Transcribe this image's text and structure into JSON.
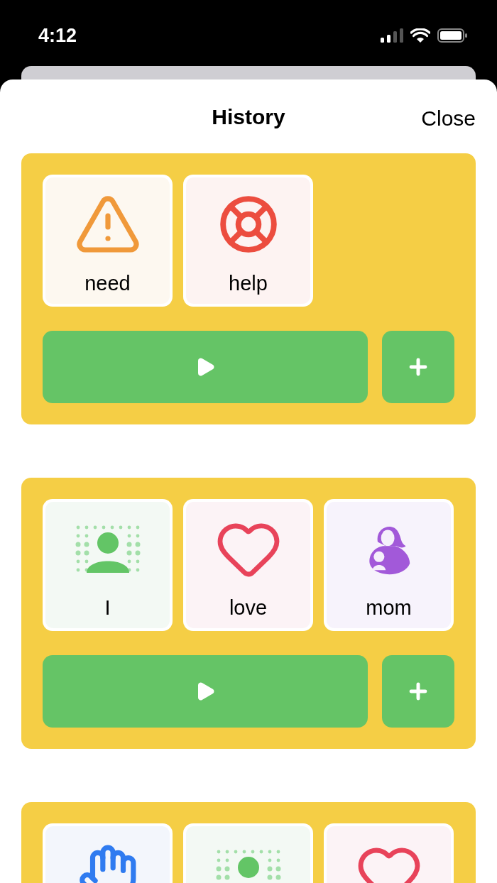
{
  "status_bar": {
    "time": "4:12"
  },
  "header": {
    "title": "History",
    "close": "Close"
  },
  "phrases": [
    {
      "actions": true,
      "tiles": [
        {
          "kind": "warning",
          "label": "need"
        },
        {
          "kind": "lifebuoy",
          "label": "help"
        }
      ]
    },
    {
      "actions": true,
      "tiles": [
        {
          "kind": "person",
          "label": "I"
        },
        {
          "kind": "heart",
          "label": "love"
        },
        {
          "kind": "mother",
          "label": "mom"
        }
      ]
    },
    {
      "actions": false,
      "tiles": [
        {
          "kind": "wave"
        },
        {
          "kind": "person"
        },
        {
          "kind": "heart"
        }
      ]
    }
  ]
}
